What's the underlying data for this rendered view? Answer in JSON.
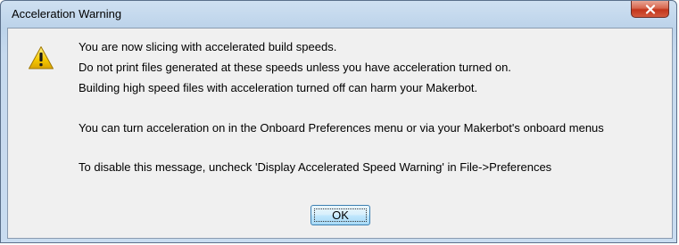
{
  "window": {
    "title": "Acceleration Warning"
  },
  "icons": {
    "close": "close-icon",
    "warning": "warning-icon"
  },
  "message": {
    "lines": [
      "You are now slicing with accelerated build speeds.",
      "Do not print files generated at these speeds unless you have acceleration turned on.",
      "Building high speed files with acceleration turned off can harm your Makerbot.",
      "You can turn acceleration on in the Onboard Preferences menu or via your Makerbot's onboard menus",
      "To disable this message, uncheck 'Display Accelerated Speed Warning' in  File->Preferences"
    ]
  },
  "buttons": {
    "ok_label": "OK"
  },
  "colors": {
    "titlebar": "#bcd3ea",
    "client_background": "#f0f0f0",
    "close_button": "#c2351b",
    "warning_icon": "#f5c800"
  }
}
